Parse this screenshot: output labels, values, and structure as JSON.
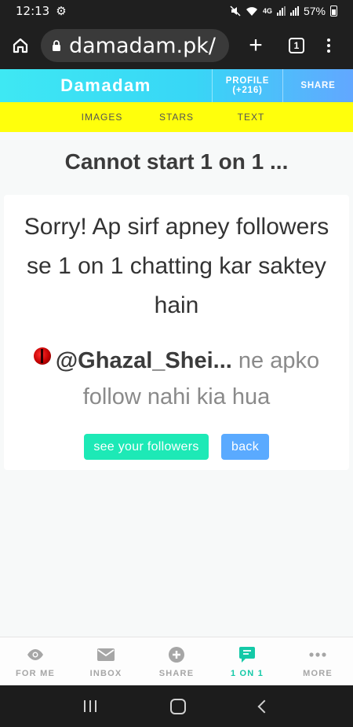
{
  "status_bar": {
    "time": "12:13",
    "battery": "57%",
    "network": "4G"
  },
  "browser": {
    "url": "damadam.pk/",
    "tab_count": "1"
  },
  "header": {
    "brand": "Damadam",
    "profile_label": "PROFILE",
    "profile_count": "(+216)",
    "share_label": "SHARE"
  },
  "subnav": [
    "IMAGES",
    "STARS",
    "TEXT"
  ],
  "page": {
    "title": "Cannot start 1 on 1 ...",
    "message": "Sorry! Ap sirf apney followers se 1 on 1 chatting kar saktey hain",
    "username": "@Ghazal_Shei...",
    "user_message": "ne apko follow nahi kia hua",
    "followers_button": "see your followers",
    "back_button": "back"
  },
  "bottom_nav": [
    {
      "label": "FOR ME",
      "icon": "eye-icon",
      "active": false
    },
    {
      "label": "INBOX",
      "icon": "envelope-icon",
      "active": false
    },
    {
      "label": "SHARE",
      "icon": "plus-circle-icon",
      "active": false
    },
    {
      "label": "1 ON 1",
      "icon": "chat-icon",
      "active": true
    },
    {
      "label": "MORE",
      "icon": "ellipsis-icon",
      "active": false
    }
  ],
  "colors": {
    "accent": "#14c9a7",
    "subnav_bg": "#ffff0c",
    "followers_button": "#1de9b6",
    "back_button": "#5aaaff"
  }
}
